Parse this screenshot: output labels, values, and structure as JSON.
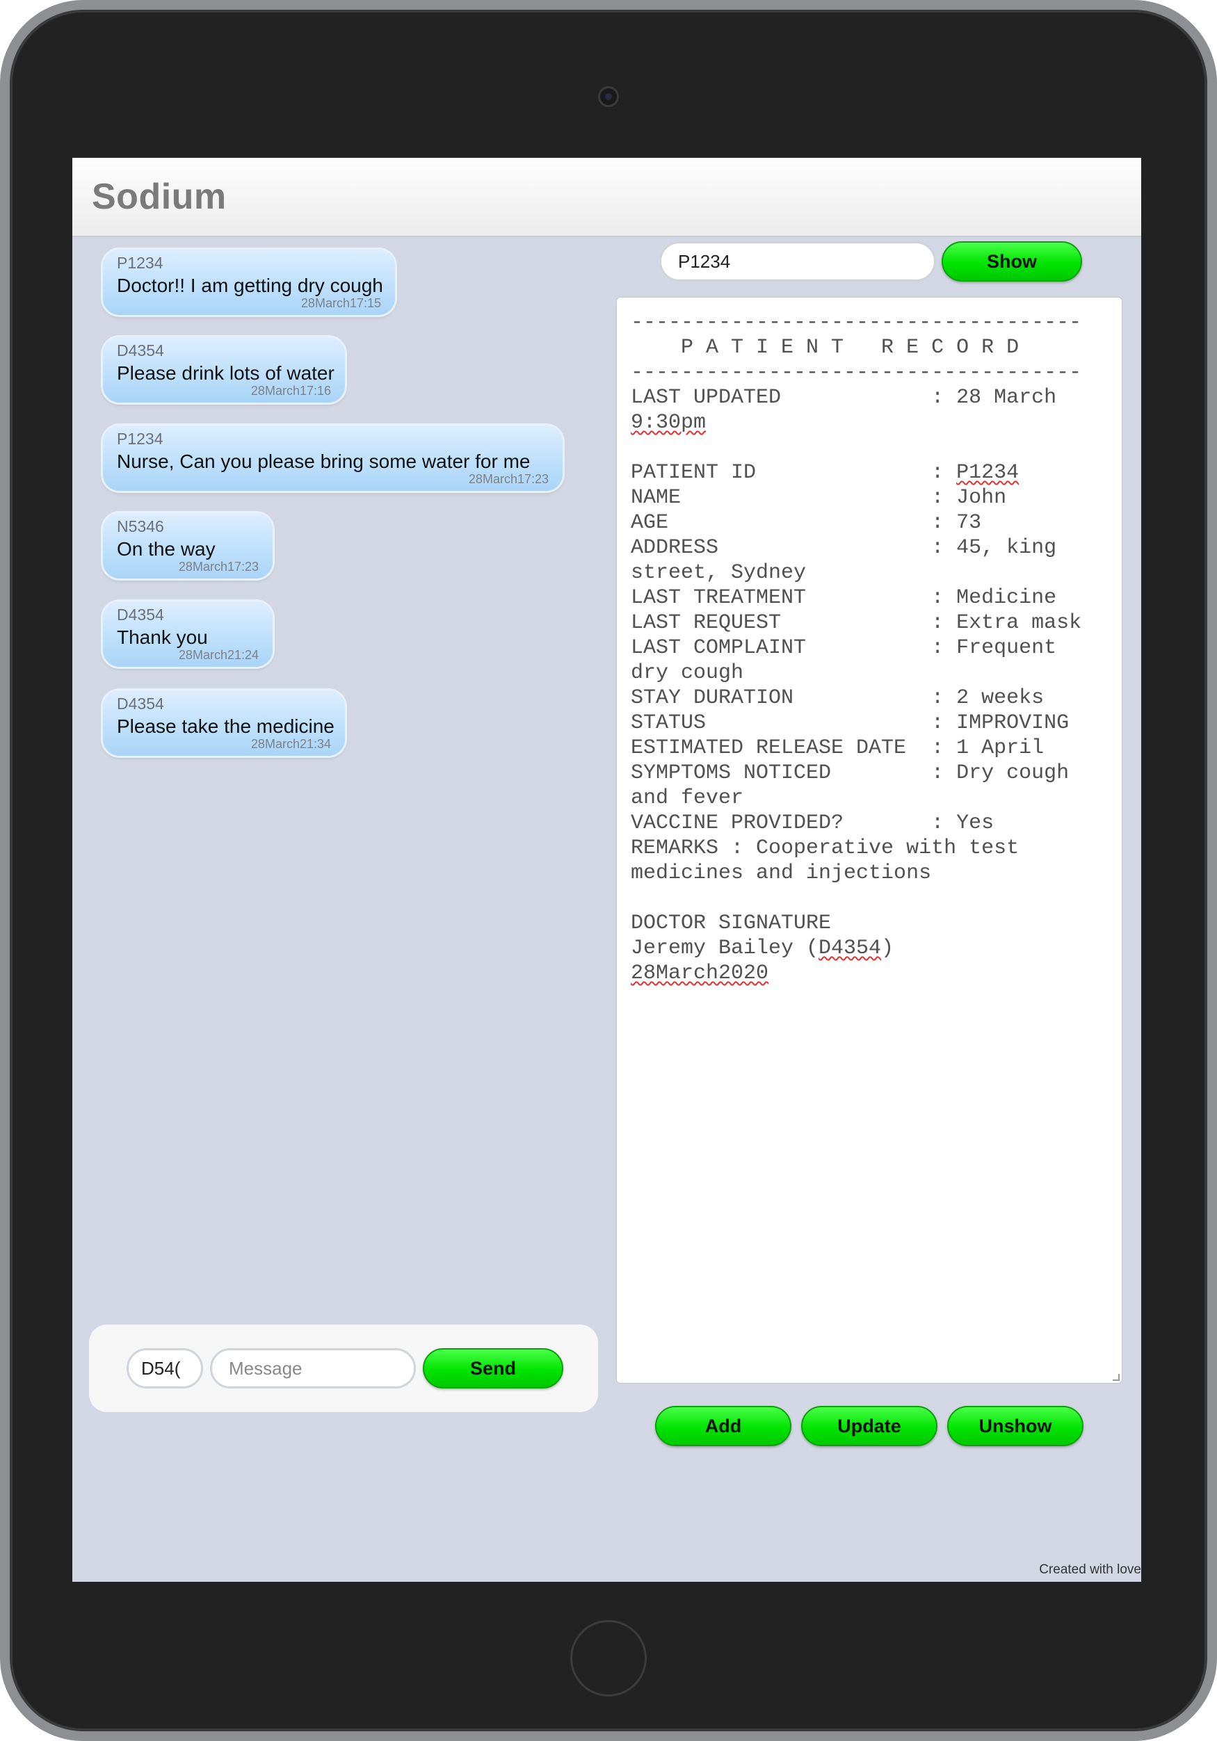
{
  "app": {
    "title": "Sodium"
  },
  "messages": [
    {
      "sender": "P1234",
      "text": "Doctor!! I am getting dry cough",
      "time": "28March17:15"
    },
    {
      "sender": "D4354",
      "text": "Please drink lots of water",
      "time": "28March17:16"
    },
    {
      "sender": "P1234",
      "text": "Nurse, Can you please bring some water for me",
      "time": "28March17:23"
    },
    {
      "sender": "N5346",
      "text": "On the way",
      "time": "28March17:23"
    },
    {
      "sender": "D4354",
      "text": "Thank you",
      "time": "28March21:24"
    },
    {
      "sender": "D4354",
      "text": "Please take the medicine",
      "time": "28March21:34"
    }
  ],
  "composer": {
    "id_value": "D54(",
    "message_placeholder": "Message",
    "send_label": "Send"
  },
  "record_lookup": {
    "patient_id_value": "P1234",
    "show_label": "Show"
  },
  "record": {
    "rule": "------------------------------------",
    "heading": "    P A T I E N T   R E C O R D",
    "last_updated_line": "LAST UPDATED            : 28 March",
    "last_updated_time": "9:30pm",
    "patient_id_label": "PATIENT ID              : ",
    "patient_id": "P1234",
    "name_line": "NAME                    : John",
    "age_line": "AGE                     : 73",
    "address_line": "ADDRESS                 : 45, king",
    "address_cont": "street, Sydney",
    "last_treatment_line": "LAST TREATMENT          : Medicine",
    "last_request_line": "LAST REQUEST            : Extra mask",
    "last_complaint_line": "LAST COMPLAINT          : Frequent",
    "last_complaint_cont": "dry cough",
    "stay_line": "STAY DURATION           : 2 weeks",
    "status_line": "STATUS                  : IMPROVING",
    "release_line": "ESTIMATED RELEASE DATE  : 1 April",
    "symptoms_line": "SYMPTOMS NOTICED        : Dry cough",
    "symptoms_cont": "and fever",
    "vaccine_line": "VACCINE PROVIDED?       : Yes",
    "remarks_line": "REMARKS : Cooperative with test",
    "remarks_cont": "medicines and injections",
    "signature_label": "DOCTOR SIGNATURE",
    "doctor_name": "Jeremy Bailey (",
    "doctor_id": "D4354",
    "doctor_close": ")",
    "signed_date": "28March2020"
  },
  "record_actions": {
    "add_label": "Add",
    "update_label": "Update",
    "unshow_label": "Unshow"
  },
  "footer": {
    "text": "Created with love"
  }
}
